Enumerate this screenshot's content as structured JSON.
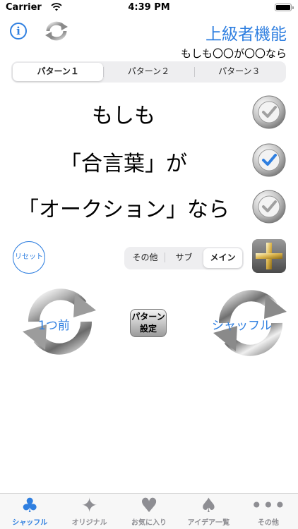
{
  "status": {
    "carrier": "Carrier",
    "time": "4:39 PM"
  },
  "nav": {
    "title": "上級者機能",
    "subtitle": "もしも〇〇が〇〇なら"
  },
  "pattern_tabs": [
    {
      "label": "パターン１",
      "selected": true
    },
    {
      "label": "パターン２",
      "selected": false
    },
    {
      "label": "パターン３",
      "selected": false
    }
  ],
  "rows": [
    {
      "text": "もしも",
      "checked": false
    },
    {
      "text": "「合言葉」が",
      "checked": true
    },
    {
      "text": "「オークション」なら",
      "checked": false
    }
  ],
  "controls": {
    "reset_label": "リセット",
    "type_tabs": [
      {
        "label": "その他",
        "selected": false
      },
      {
        "label": "サブ",
        "selected": false
      },
      {
        "label": "メイン",
        "selected": true
      }
    ],
    "prev_label": "1つ前",
    "next_label": "シャッフル",
    "pattern_setting_label_1": "パターン",
    "pattern_setting_label_2": "設定"
  },
  "tabbar": [
    {
      "label": "シャッフル",
      "icon": "club-icon",
      "active": true
    },
    {
      "label": "オリジナル",
      "icon": "sparkle-icon",
      "active": false
    },
    {
      "label": "お気に入り",
      "icon": "heart-icon",
      "active": false
    },
    {
      "label": "アイデア一覧",
      "icon": "spade-icon",
      "active": false
    },
    {
      "label": "その他",
      "icon": "more-icon",
      "active": false
    }
  ],
  "colors": {
    "accent": "#2f7fe0",
    "check_active": "#2f7fe0"
  }
}
